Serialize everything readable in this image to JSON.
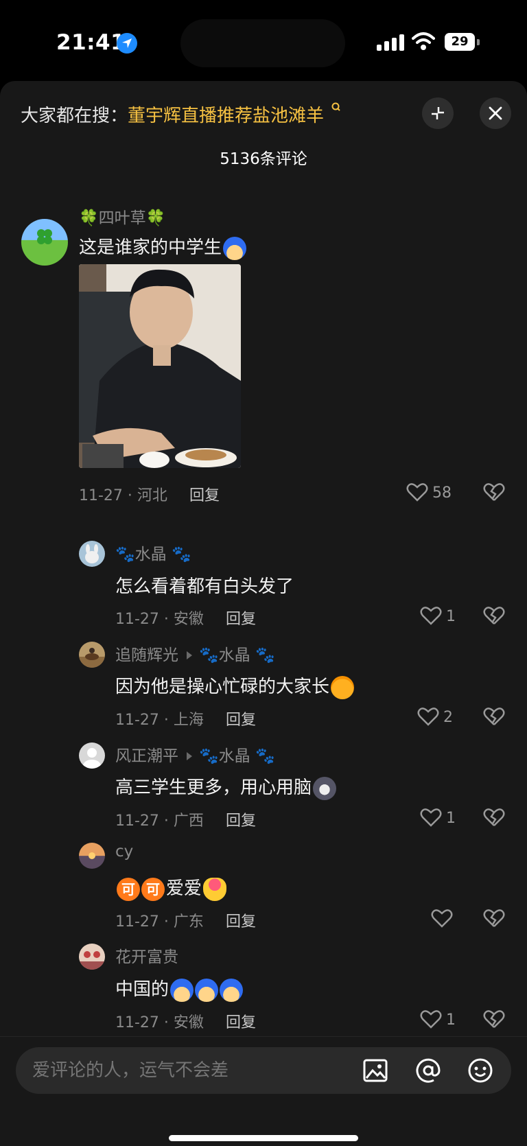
{
  "status_bar": {
    "time": "21:41",
    "battery": "29"
  },
  "header": {
    "search_prefix": "大家都在搜：",
    "search_keyword": "董宇辉直播推荐盐池滩羊",
    "comment_count": "5136条评论"
  },
  "comments": [
    {
      "name": "🍀四叶草🍀",
      "text": "这是谁家的中学生",
      "date_loc": "11-27 · 河北",
      "reply": "回复",
      "likes": "58"
    },
    {
      "name": "🐾水晶 🐾",
      "text": "怎么看着都有白头发了",
      "date_loc": "11-27 · 安徽",
      "reply": "回复",
      "likes": "1"
    },
    {
      "name": "追随辉光",
      "reply_to": "🐾水晶 🐾",
      "text": "因为他是操心忙碌的大家长",
      "date_loc": "11-27 · 上海",
      "reply": "回复",
      "likes": "2"
    },
    {
      "name": "风正潮平",
      "reply_to": "🐾水晶 🐾",
      "text": "高三学生更多，用心用脑",
      "date_loc": "11-27 · 广西",
      "reply": "回复",
      "likes": "1"
    },
    {
      "name": "cy",
      "text": "爱爱",
      "emoji_text": "可",
      "date_loc": "11-27 · 广东",
      "reply": "回复",
      "likes": ""
    },
    {
      "name": "花开富贵",
      "text": "中国的",
      "date_loc": "11-27 · 安徽",
      "reply": "回复",
      "likes": "1"
    }
  ],
  "input": {
    "placeholder": "爱评论的人，运气不会差"
  },
  "icons": [
    "location-arrow-icon",
    "signal-icon",
    "wifi-icon",
    "battery-icon",
    "search-icon",
    "expand-icon",
    "close-icon",
    "heart-icon",
    "broken-heart-icon",
    "image-icon",
    "at-icon",
    "emoji-face-icon"
  ],
  "colors": {
    "background": "#181818",
    "keyword": "#f6c142",
    "muted": "#8a8a8a"
  }
}
